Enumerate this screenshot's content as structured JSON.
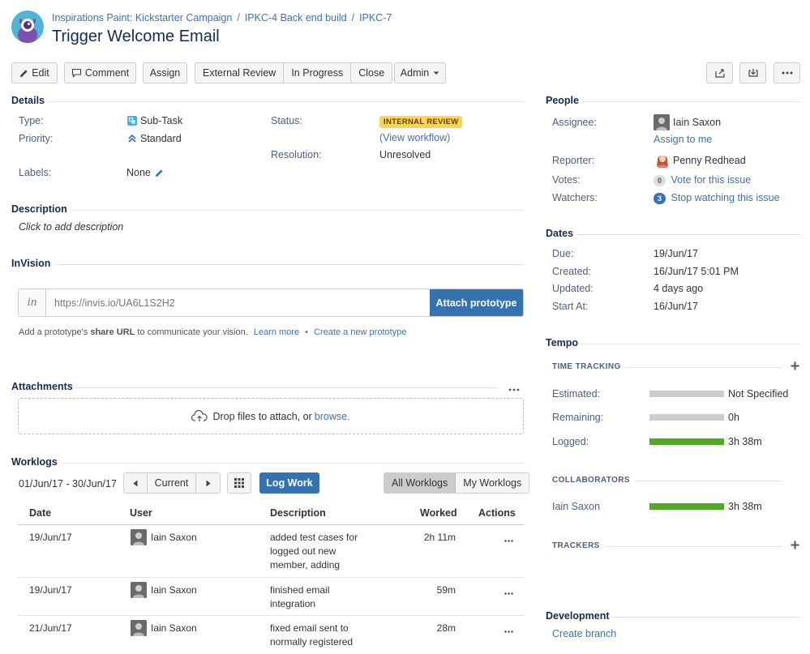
{
  "header": {
    "breadcrumbs": [
      "Inspirations Paint: Kickstarter Campaign",
      "IPKC-4 Back end build",
      "IPKC-7"
    ],
    "title": "Trigger Welcome Email"
  },
  "toolbar": {
    "edit": "Edit",
    "comment": "Comment",
    "assign": "Assign",
    "external_review": "External Review",
    "in_progress": "In Progress",
    "close": "Close",
    "admin": "Admin"
  },
  "details": {
    "title": "Details",
    "type_label": "Type:",
    "type_value": "Sub-Task",
    "priority_label": "Priority:",
    "priority_value": "Standard",
    "labels_label": "Labels:",
    "labels_value": "None",
    "status_label": "Status:",
    "status_value": "INTERNAL REVIEW",
    "view_workflow": "(View workflow)",
    "resolution_label": "Resolution:",
    "resolution_value": "Unresolved"
  },
  "description": {
    "title": "Description",
    "placeholder": "Click to add description"
  },
  "invision": {
    "title": "InVision",
    "logo": "in",
    "url_value": "https://invis.io/UA6L1S2H2",
    "attach_button": "Attach prototype",
    "help_prefix": "Add a prototype's ",
    "help_bold": "share URL",
    "help_suffix": " to communicate your vision.",
    "learn_more": "Learn more",
    "bullet": "•",
    "create_new": "Create a new prototype"
  },
  "attachments": {
    "title": "Attachments",
    "drop_text": "Drop files to attach, or ",
    "browse": "browse."
  },
  "worklogs": {
    "title": "Worklogs",
    "date_range": "01/Jun/17 - 30/Jun/17",
    "current": "Current",
    "log_work": "Log Work",
    "all_worklogs": "All Worklogs",
    "my_worklogs": "My Worklogs",
    "columns": [
      "Date",
      "User",
      "Description",
      "Worked",
      "Actions"
    ],
    "rows": [
      {
        "date": "19/Jun/17",
        "user": "Iain Saxon",
        "desc_lines": [
          "added test cases for",
          "logged out new",
          "member, adding"
        ],
        "worked": "2h 11m"
      },
      {
        "date": "19/Jun/17",
        "user": "Iain Saxon",
        "desc_lines": [
          "finished email",
          "integration"
        ],
        "worked": "59m"
      },
      {
        "date": "21/Jun/17",
        "user": "Iain Saxon",
        "desc_lines": [
          "fixed email sent to",
          "normally registered"
        ],
        "worked": "28m"
      }
    ]
  },
  "people": {
    "title": "People",
    "assignee_label": "Assignee:",
    "assignee_value": "Iain Saxon",
    "assign_to_me": "Assign to me",
    "reporter_label": "Reporter:",
    "reporter_value": "Penny Redhead",
    "votes_label": "Votes:",
    "votes_count": "0",
    "vote_link": "Vote for this issue",
    "watchers_label": "Watchers:",
    "watchers_count": "3",
    "watch_link": "Stop watching this issue"
  },
  "dates": {
    "title": "Dates",
    "due_label": "Due:",
    "due_value": "19/Jun/17",
    "created_label": "Created:",
    "created_value": "16/Jun/17 5:01 PM",
    "updated_label": "Updated:",
    "updated_value": "4 days ago",
    "start_label": "Start At:",
    "start_value": "16/Jun/17"
  },
  "tempo": {
    "title": "Tempo",
    "time_tracking": "TIME TRACKING",
    "estimated_label": "Estimated:",
    "estimated_value": "Not Specified",
    "remaining_label": "Remaining:",
    "remaining_value": "0h",
    "logged_label": "Logged:",
    "logged_value": "3h 38m",
    "collaborators": "COLLABORATORS",
    "collab_name": "Iain Saxon",
    "collab_value": "3h 38m",
    "trackers": "TRACKERS"
  },
  "development": {
    "title": "Development",
    "create_branch": "Create branch"
  },
  "colors": {
    "link": "#3b73af",
    "primary_button": "#3572b0",
    "status_badge": "#ffd351",
    "progress_green": "#51a825",
    "progress_gray": "#ccc"
  }
}
